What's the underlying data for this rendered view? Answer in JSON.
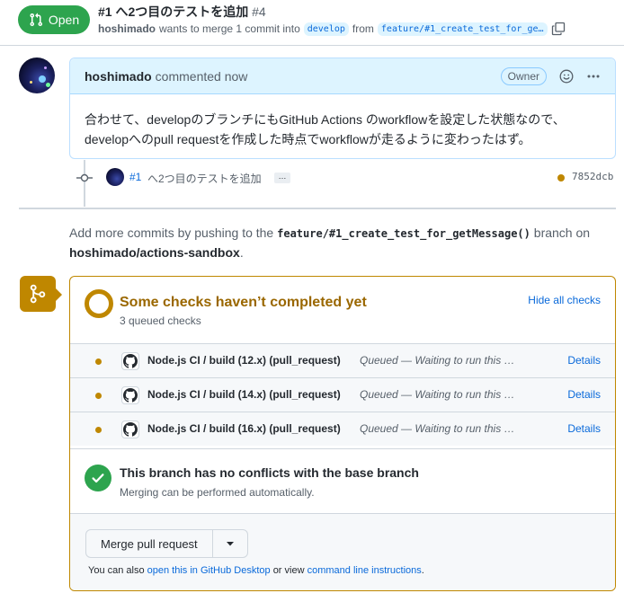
{
  "header": {
    "state": "Open",
    "title": "#1 へ2つ目のテストを追加",
    "number": "#4",
    "author": "hoshimado",
    "meta_text": "wants to merge 1 commit into",
    "base_branch": "develop",
    "from_text": "from",
    "head_branch": "feature/#1_create_test_for_ge…"
  },
  "comment": {
    "author": "hoshimado",
    "when": "commented now",
    "role": "Owner",
    "body_line1": "合わせて、developのブランチにもGitHub Actions のworkflowを設定した状態なので、",
    "body_line2": "developへのpull requestを作成した時点でworkflowが走るように変わったはず。"
  },
  "commit": {
    "issue_ref": "#1",
    "message": "へ2つ目のテストを追加",
    "expand": "…",
    "sha": "7852dcb"
  },
  "add_commits": {
    "prefix": "Add more commits by pushing to the",
    "branch": "feature/#1_create_test_for_getMessage()",
    "middle": "branch on",
    "repo": "hoshimado/actions-sandbox",
    "suffix": "."
  },
  "checks": {
    "title": "Some checks haven’t completed yet",
    "subtitle": "3 queued checks",
    "hide_label": "Hide all checks",
    "items": [
      {
        "name": "Node.js CI / build (12.x) (pull_request)",
        "status": "Queued — Waiting to run this check...",
        "details": "Details"
      },
      {
        "name": "Node.js CI / build (14.x) (pull_request)",
        "status": "Queued — Waiting to run this check...",
        "details": "Details"
      },
      {
        "name": "Node.js CI / build (16.x) (pull_request)",
        "status": "Queued — Waiting to run this check...",
        "details": "Details"
      }
    ]
  },
  "conflicts": {
    "title": "This branch has no conflicts with the base branch",
    "subtitle": "Merging can be performed automatically."
  },
  "merge": {
    "button_label": "Merge pull request",
    "hint_prefix": "You can also",
    "hint_link1": "open this in GitHub Desktop",
    "hint_middle": "or view",
    "hint_link2": "command line instructions",
    "hint_suffix": "."
  },
  "colors": {
    "open_green": "#2da44e",
    "pending_amber": "#bf8700",
    "link_blue": "#0969da"
  }
}
